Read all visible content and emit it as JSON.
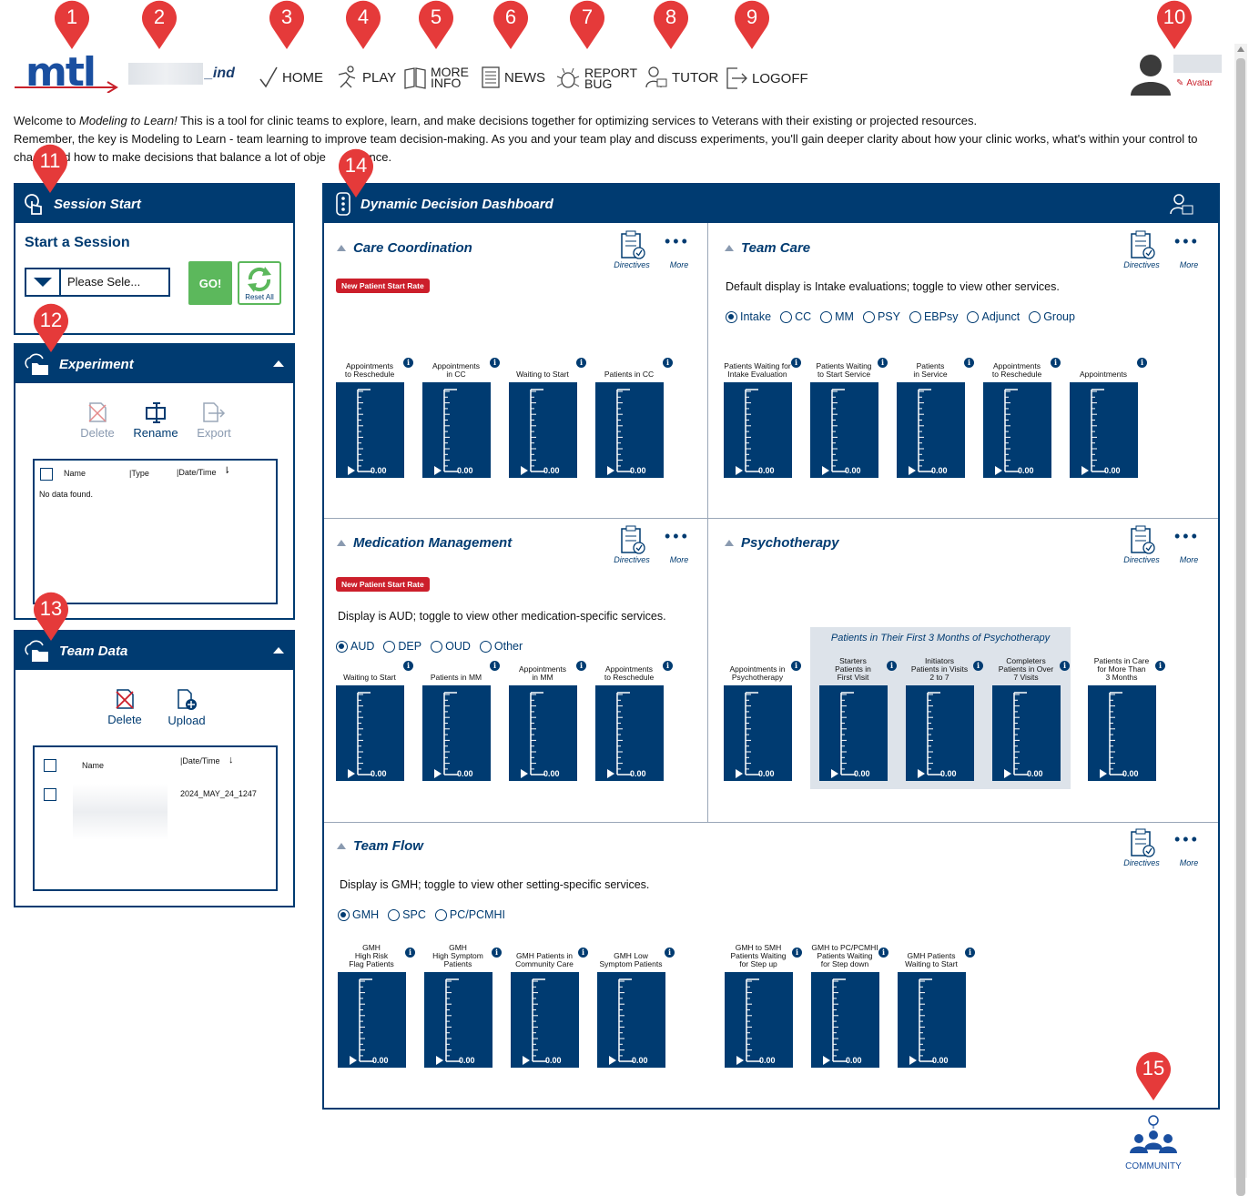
{
  "header": {
    "logo": "mtl",
    "username_suffix": "_ind",
    "nav": {
      "home": "HOME",
      "play": "PLAY",
      "more_info": [
        "MORE",
        "INFO"
      ],
      "news": "NEWS",
      "report_bug": [
        "REPORT",
        "BUG"
      ],
      "tutor": "TUTOR",
      "logoff": "LOGOFF"
    },
    "avatar_link": "Avatar"
  },
  "markers": [
    "1",
    "2",
    "3",
    "4",
    "5",
    "6",
    "7",
    "8",
    "9",
    "10",
    "11",
    "12",
    "13",
    "14",
    "15"
  ],
  "welcome": {
    "line1_prefix": "Welcome to ",
    "line1_em": "Modeling to Learn!",
    "line1_rest": " This is a tool for clinic teams to explore, learn, and make decisions together for optimizing services to Veterans with their existing or projected resources.",
    "line2": "Remember, the key is Modeling to Learn - team learning to improve team decision-making. As you and your team play and discuss experiments, you'll gain deeper clarity about how your clinic works, what's within your control to",
    "line3_a": "cha",
    "line3_b": "nd how to make decisions that balance a lot of obje",
    "line3_c": "at once."
  },
  "session": {
    "header": "Session Start",
    "title": "Start a Session",
    "select_value": "Please Sele...",
    "go": "GO!",
    "reset": "Reset All"
  },
  "experiment": {
    "header": "Experiment",
    "delete": "Delete",
    "rename": "Rename",
    "export": "Export",
    "col_name": "Name",
    "col_type": "|Type",
    "col_date": "|Date/Time",
    "empty": "No data found."
  },
  "team_data": {
    "header": "Team Data",
    "delete": "Delete",
    "upload": "Upload",
    "col_name": "Name",
    "col_date": "|Date/Time",
    "row_date": "2024_MAY_24_1247"
  },
  "dashboard": {
    "title": "Dynamic Decision Dashboard",
    "directives": "Directives",
    "more": "More",
    "gauge_value": "0.00",
    "care_coordination": {
      "title": "Care Coordination",
      "badge": "New Patient Start Rate",
      "gauges": [
        "Appointments\nto Reschedule",
        "Appointments\nin CC",
        "Waiting to Start",
        "Patients in CC"
      ]
    },
    "team_care": {
      "title": "Team Care",
      "desc": "Default display is Intake evaluations; toggle to view other services.",
      "radios": [
        "Intake",
        "CC",
        "MM",
        "PSY",
        "EBPsy",
        "Adjunct",
        "Group"
      ],
      "selected": "Intake",
      "gauges": [
        "Patients Waiting for\nIntake Evaluation",
        "Patients Waiting\nto Start Service",
        "Patients\nin Service",
        "Appointments\nto Reschedule",
        "Appointments"
      ]
    },
    "medication_management": {
      "title": "Medication Management",
      "badge": "New Patient Start Rate",
      "desc": "Display is AUD; toggle to view other medication-specific services.",
      "radios": [
        "AUD",
        "DEP",
        "OUD",
        "Other"
      ],
      "selected": "AUD",
      "gauges": [
        "Waiting to Start",
        "Patients in MM",
        "Appointments\nin MM",
        "Appointments\nto Reschedule"
      ]
    },
    "psychotherapy": {
      "title": "Psychotherapy",
      "group_title": "Patients in Their First 3 Months of Psychotherapy",
      "gauges": [
        "Appointments in\nPsychotherapy",
        "Starters\nPatients in\nFirst Visit",
        "Initiators\nPatients in Visits\n2 to 7",
        "Completers\nPatients in Over\n7 Visits",
        "Patients in Care\nfor More Than\n3 Months"
      ]
    },
    "team_flow": {
      "title": "Team Flow",
      "desc": "Display is GMH; toggle to view other setting-specific services.",
      "radios": [
        "GMH",
        "SPC",
        "PC/PCMHI"
      ],
      "selected": "GMH",
      "gauges": [
        "GMH\nHigh Risk\nFlag Patients",
        "GMH\nHigh Symptom\nPatients",
        "GMH Patients in\nCommunity Care",
        "GMH Low\nSymptom Patients",
        "GMH to SMH\nPatients Waiting\nfor Step up",
        "GMH to PC/PCMHI\nPatients Waiting\nfor Step down",
        "GMH Patients\nWaiting to Start"
      ]
    }
  },
  "community": "COMMUNITY",
  "colors": {
    "navy": "#003b71",
    "marker_red": "#e53a3a",
    "go_green": "#5cb85c",
    "badge_red": "#cc1f2b"
  }
}
